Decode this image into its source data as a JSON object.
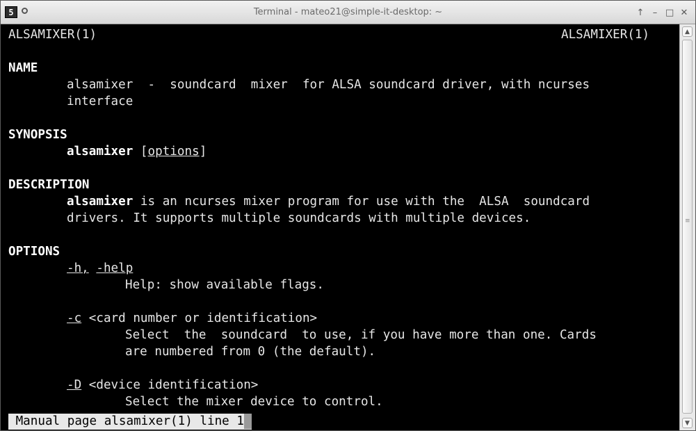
{
  "window": {
    "title": "Terminal - mateo21@simple-it-desktop: ~",
    "app_icon": "5",
    "controls": [
      "↑",
      "–",
      "□",
      "✕"
    ]
  },
  "man": {
    "header_left": "ALSAMIXER(1)",
    "header_right": "ALSAMIXER(1)",
    "name_heading": "NAME",
    "name_line1": "alsamixer  -  soundcard  mixer  for ALSA soundcard driver, with ncurses",
    "name_line2": "interface",
    "synopsis_heading": "SYNOPSIS",
    "synopsis_cmd": "alsamixer",
    "synopsis_open": " [",
    "synopsis_opt": "options",
    "synopsis_close": "]",
    "description_heading": "DESCRIPTION",
    "desc_cmd": "alsamixer",
    "desc_line1_rest": " is an ncurses mixer program for use with the  ALSA  soundcard",
    "desc_line2": "drivers. It supports multiple soundcards with multiple devices.",
    "options_heading": "OPTIONS",
    "opt_h_short": "-h,",
    "opt_h_long": "-help",
    "opt_h_desc": "Help: show available flags.",
    "opt_c_flag": "-c",
    "opt_c_arg": " <card number or identification>",
    "opt_c_desc1": "Select  the  soundcard  to use, if you have more than one. Cards",
    "opt_c_desc2": "are numbered from 0 (the default).",
    "opt_d_flag": "-D",
    "opt_d_arg": " <device identification>",
    "opt_d_desc1": "Select the mixer device to control."
  },
  "status_bar": {
    "text": " Manual page alsamixer(1) line 1"
  }
}
